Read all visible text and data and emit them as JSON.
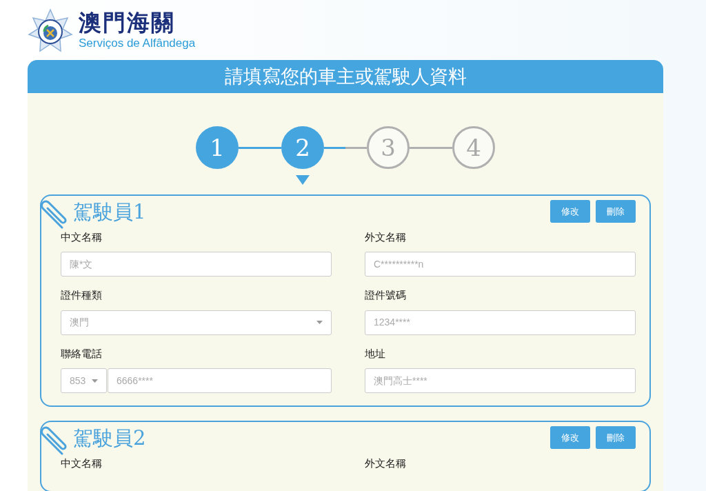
{
  "logo": {
    "title": "澳門海關",
    "subtitle": "Serviços de Alfândega"
  },
  "panel": {
    "title": "請填寫您的車主或駕駛人資料"
  },
  "steps": [
    {
      "label": "1",
      "completed": true,
      "selected": false
    },
    {
      "label": "2",
      "completed": false,
      "selected": true
    },
    {
      "label": "3",
      "completed": false,
      "selected": false
    },
    {
      "label": "4",
      "completed": false,
      "selected": false
    }
  ],
  "drivers": [
    {
      "title": "駕駛員1",
      "buttons": [
        "修改",
        "刪除"
      ],
      "fields": [
        {
          "kind": "text",
          "label": "中文名稱",
          "value": "陳*文"
        },
        {
          "kind": "text",
          "label": "外文名稱",
          "value": "C**********n"
        },
        {
          "kind": "select",
          "label": "證件種類",
          "value": "澳門"
        },
        {
          "kind": "text",
          "label": "證件號碼",
          "value": "1234****"
        },
        {
          "kind": "phone",
          "label": "聯絡電話",
          "code": "853",
          "value": "6666****"
        },
        {
          "kind": "text",
          "label": "地址",
          "value": "澳門高士****"
        }
      ]
    },
    {
      "title": "駕駛員2",
      "buttons": [
        "修改",
        "刪除"
      ],
      "fields": [
        {
          "label": "中文名稱"
        },
        {
          "label": "外文名稱"
        }
      ]
    }
  ]
}
